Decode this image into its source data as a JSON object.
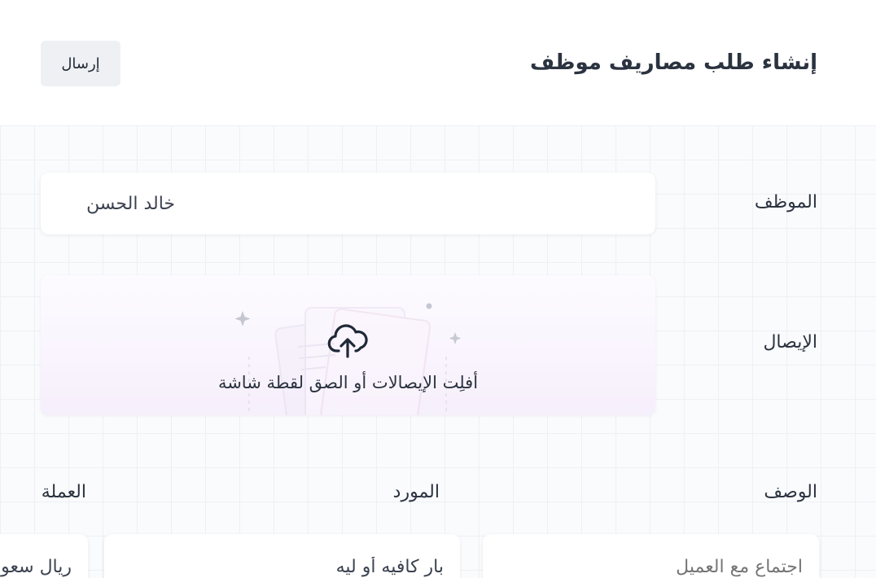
{
  "header": {
    "title": "إنشاء طلب مصاريف موظف",
    "submit_label": "إرسال"
  },
  "form": {
    "employee": {
      "label": "الموظف",
      "value": "خالد الحسن"
    },
    "receipt": {
      "label": "الإيصال",
      "dropzone_text": "أفلِت الإيصالات أو الصق لقطة شاشة",
      "icon": "cloud-upload-icon"
    },
    "description": {
      "label": "الوصف",
      "placeholder": "اجتماع مع العميل"
    },
    "vendor": {
      "label": "المورد",
      "value": "بار كافيه أو ليه"
    },
    "currency": {
      "label": "العملة",
      "value": "ريال سعودي"
    }
  },
  "colors": {
    "title": "#2b3340",
    "button_bg": "#eef0f4",
    "dropzone_tint": "#f6effc"
  }
}
